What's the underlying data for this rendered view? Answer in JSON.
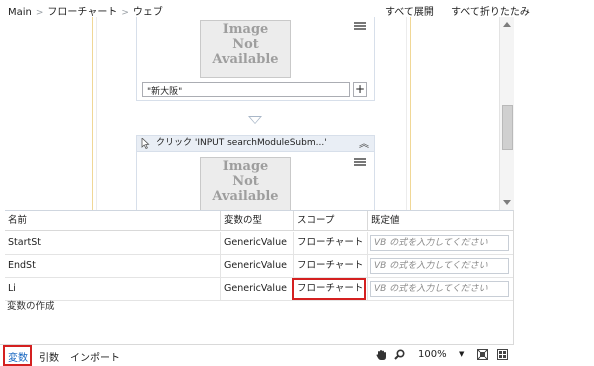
{
  "breadcrumb": {
    "items": [
      "Main",
      "フローチャート",
      "ウェブ"
    ]
  },
  "header_actions": {
    "expand_all": "すべて展開",
    "collapse_all": "すべて折りたたみ"
  },
  "designer": {
    "image_placeholder": [
      "Image",
      "Not",
      "Available"
    ],
    "type_into_value": "\"新大阪\"",
    "plus_label": "+",
    "click_activity_title": "クリック 'INPUT  searchModuleSubm...'",
    "collapse_glyph": "«"
  },
  "variables_panel": {
    "columns": [
      "名前",
      "変数の型",
      "スコープ",
      "既定値"
    ],
    "rows": [
      {
        "name": "StartSt",
        "type": "GenericValue",
        "scope": "フローチャート",
        "default_placeholder": "VB の式を入力してください"
      },
      {
        "name": "EndSt",
        "type": "GenericValue",
        "scope": "フローチャート",
        "default_placeholder": "VB の式を入力してください"
      },
      {
        "name": "Li",
        "type": "GenericValue",
        "scope": "フローチャート",
        "default_placeholder": "VB の式を入力してください"
      }
    ],
    "create_variable": "変数の作成"
  },
  "statusbar": {
    "tabs": [
      "変数",
      "引数",
      "インポート"
    ],
    "active_tab": "変数",
    "zoom": "100%",
    "hand_icon": "hand-pan-icon",
    "search_icon": "magnifier-icon",
    "fit_icon": "fit-to-screen-icon",
    "overview_icon": "overview-icon"
  },
  "colors": {
    "highlight": "#d42020",
    "accent": "#1565c0",
    "activity_border": "#d7dfea"
  }
}
